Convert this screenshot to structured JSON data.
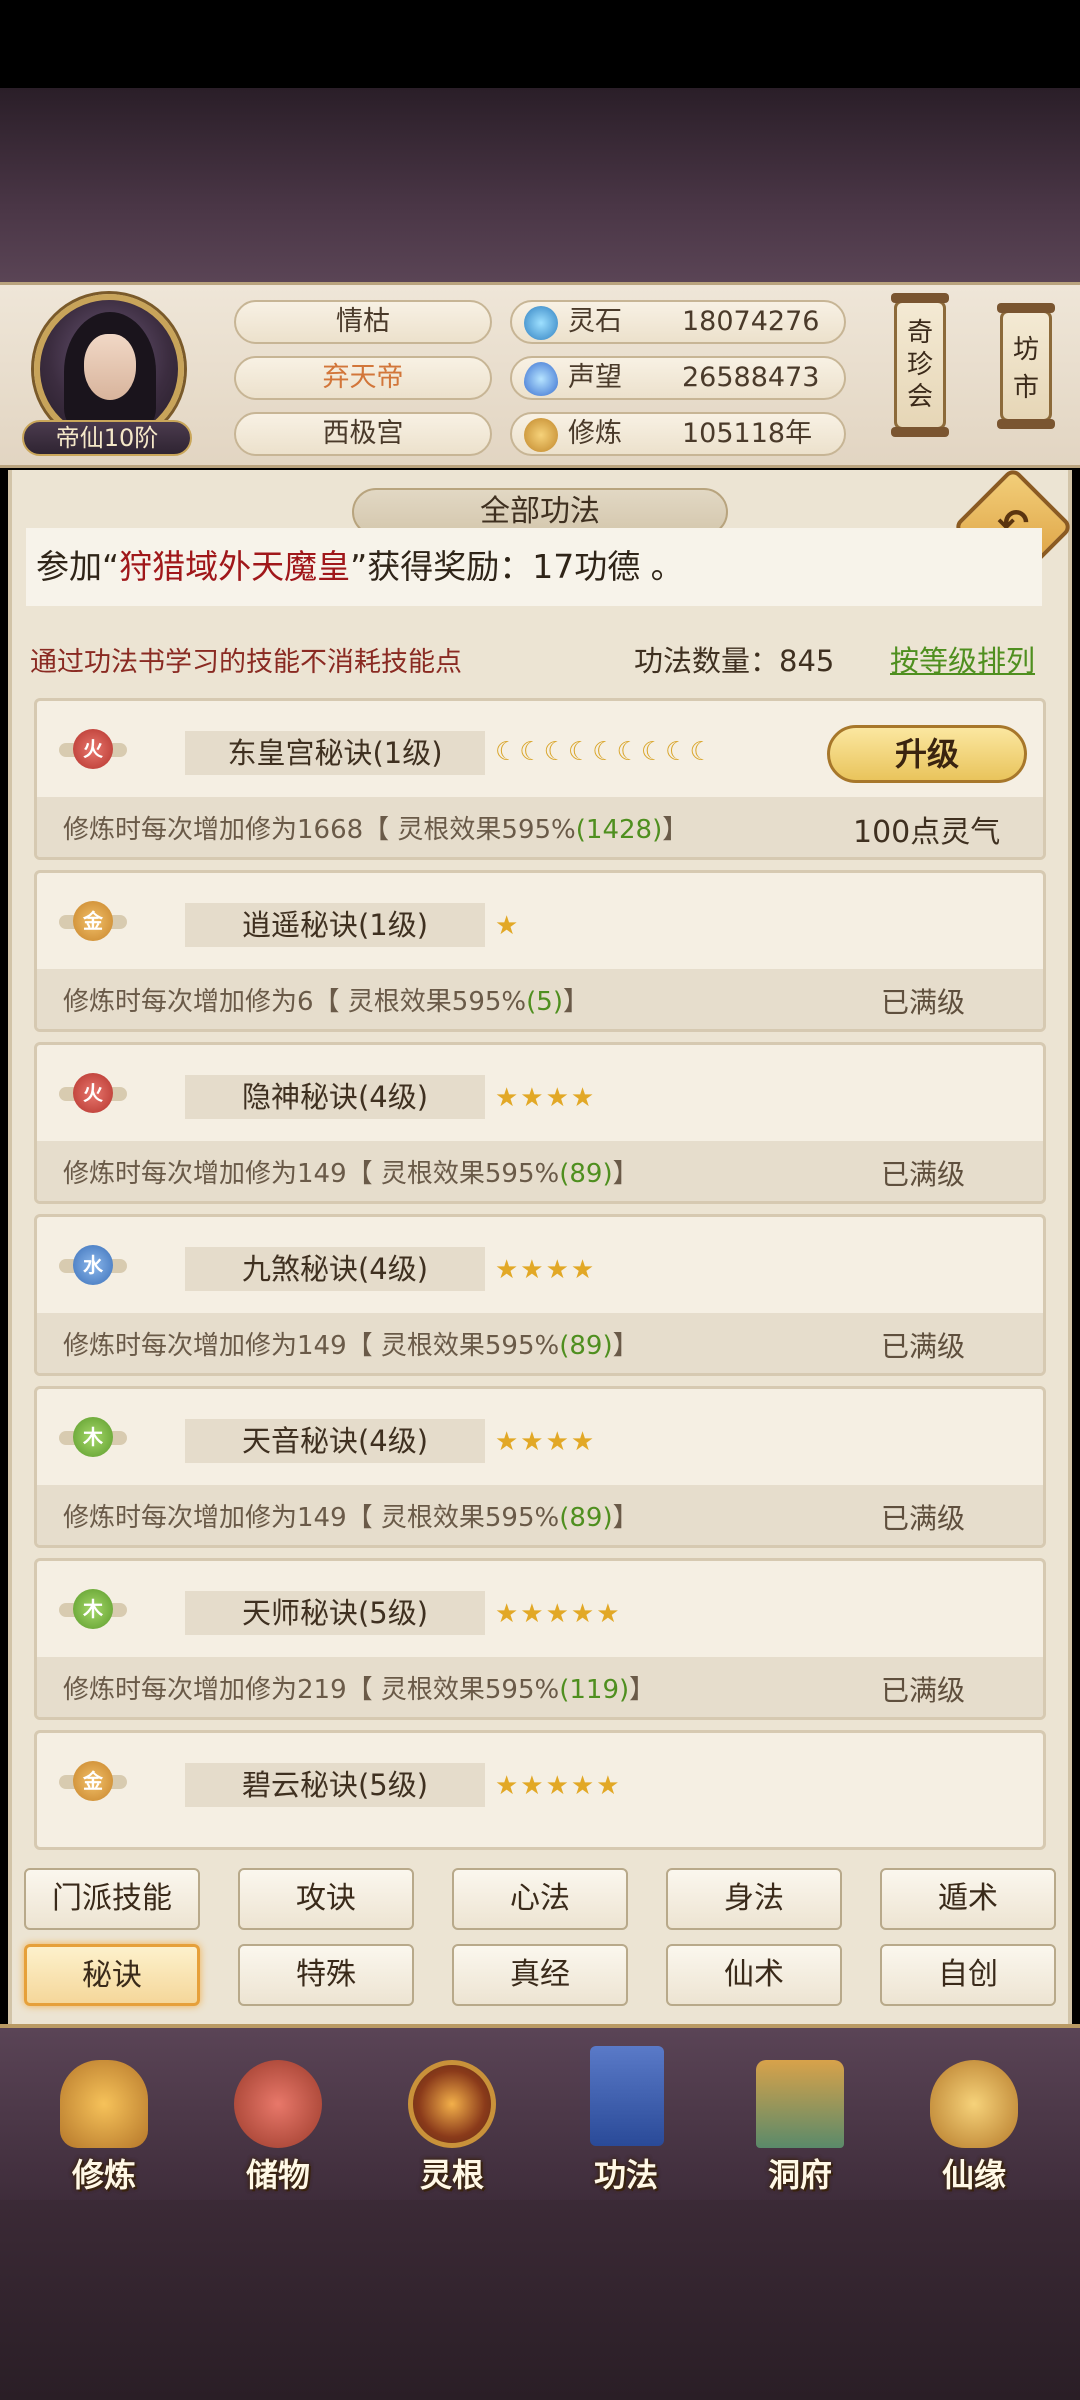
{
  "colors": {
    "accent_red": "#a0171a",
    "accent_green": "#4f8f1f",
    "panel_bg": "#ece4d3",
    "fire": "#c4433a",
    "metal": "#d89a3a",
    "water": "#4a7fc0",
    "wood": "#6aa83a"
  },
  "header": {
    "rank": "帝仙10阶",
    "names": [
      "情枯",
      "弃天帝",
      "西极宫"
    ],
    "stats": [
      {
        "label": "灵石",
        "value": "18074276",
        "icon": "spirit-stone-icon"
      },
      {
        "label": "声望",
        "value": "26588473",
        "icon": "prestige-icon"
      },
      {
        "label": "修炼",
        "value": "105118年",
        "icon": "meditation-icon"
      }
    ],
    "lanterns": [
      "奇珍会",
      "坊市"
    ]
  },
  "panel": {
    "title": "全部功法",
    "notice": {
      "prefix": "参加“",
      "highlight": "狩猎域外天魔皇",
      "suffix": "”获得奖励：17功德 。"
    },
    "tip": "通过功法书学习的技能不消耗技能点",
    "count": "功法数量：845",
    "sort": "按等级排列"
  },
  "skills": [
    {
      "element": "火",
      "name": "东皇宫秘诀(1级)",
      "rating": "☾☾☾☾☾☾☾☾☾",
      "desc": "修炼时每次增加修为1668【 灵根效果595%",
      "bonus": "(1428)",
      "desc_end": "】",
      "status": "100点灵气",
      "button": "升级"
    },
    {
      "element": "金",
      "name": "逍遥秘诀(1级)",
      "rating": "★",
      "desc": "修炼时每次增加修为6【 灵根效果595%",
      "bonus": "(5)",
      "desc_end": "】",
      "status": "已满级"
    },
    {
      "element": "火",
      "name": "隐神秘诀(4级)",
      "rating": "★★★★",
      "desc": "修炼时每次增加修为149【 灵根效果595%",
      "bonus": "(89)",
      "desc_end": "】",
      "status": "已满级"
    },
    {
      "element": "水",
      "name": "九煞秘诀(4级)",
      "rating": "★★★★",
      "desc": "修炼时每次增加修为149【 灵根效果595%",
      "bonus": "(89)",
      "desc_end": "】",
      "status": "已满级"
    },
    {
      "element": "木",
      "name": "天音秘诀(4级)",
      "rating": "★★★★",
      "desc": "修炼时每次增加修为149【 灵根效果595%",
      "bonus": "(89)",
      "desc_end": "】",
      "status": "已满级"
    },
    {
      "element": "木",
      "name": "天师秘诀(5级)",
      "rating": "★★★★★",
      "desc": "修炼时每次增加修为219【 灵根效果595%",
      "bonus": "(119)",
      "desc_end": "】",
      "status": "已满级"
    },
    {
      "element": "金",
      "name": "碧云秘诀(5级)",
      "rating": "★★★★★"
    }
  ],
  "tabs": [
    [
      "门派技能",
      "攻诀",
      "心法",
      "身法",
      "遁术"
    ],
    [
      "秘诀",
      "特殊",
      "真经",
      "仙术",
      "自创"
    ]
  ],
  "nav": [
    "修炼",
    "储物",
    "灵根",
    "功法",
    "洞府",
    "仙缘"
  ]
}
